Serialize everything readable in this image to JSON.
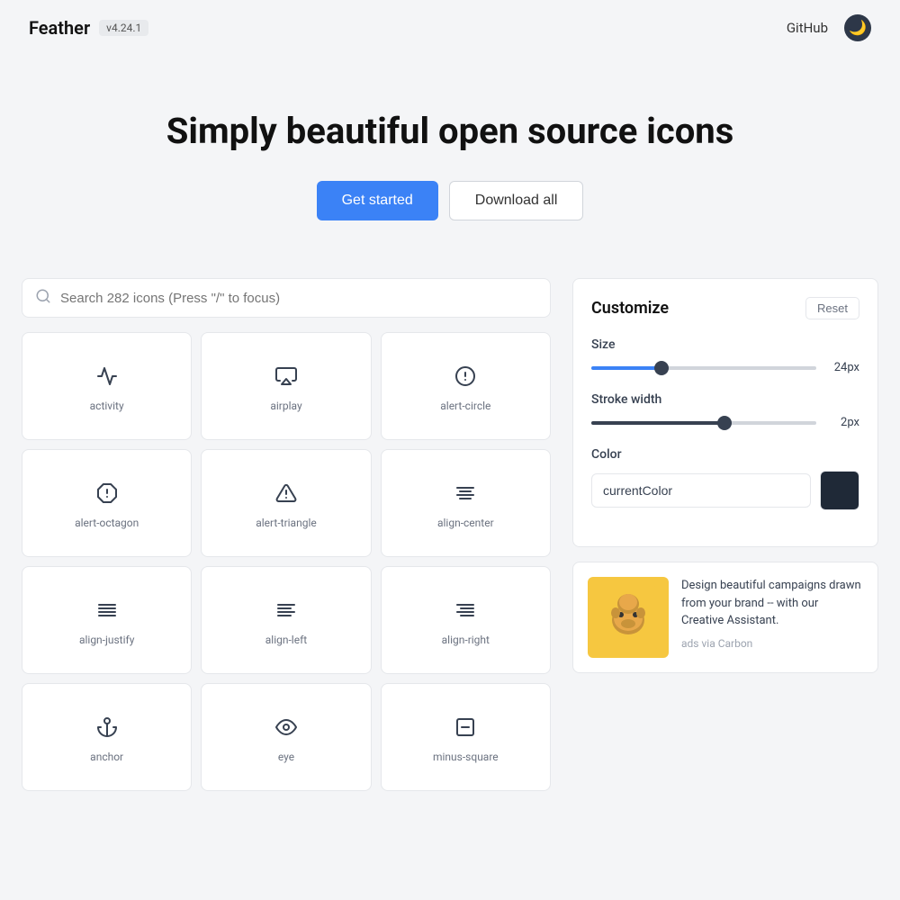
{
  "header": {
    "brand": "Feather",
    "version": "v4.24.1",
    "github_label": "GitHub",
    "dark_mode_icon": "🌙"
  },
  "hero": {
    "title": "Simply beautiful open source icons",
    "btn_get_started": "Get started",
    "btn_download": "Download all"
  },
  "search": {
    "placeholder": "Search 282 icons (Press \"/\" to focus)"
  },
  "customize": {
    "title": "Customize",
    "reset_label": "Reset",
    "size_label": "Size",
    "size_value": "24px",
    "size_percent": 30,
    "stroke_label": "Stroke width",
    "stroke_value": "2px",
    "stroke_percent": 60,
    "color_label": "Color",
    "color_value": "currentColor"
  },
  "ad": {
    "text": "Design beautiful campaigns drawn from your brand -- with our Creative Assistant.",
    "source": "ads via Carbon"
  },
  "icons": [
    {
      "id": "activity",
      "label": "activity",
      "type": "activity"
    },
    {
      "id": "airplay",
      "label": "airplay",
      "type": "airplay"
    },
    {
      "id": "alert-circle",
      "label": "alert-circle",
      "type": "alert-circle"
    },
    {
      "id": "alert-octagon",
      "label": "alert-octagon",
      "type": "alert-octagon"
    },
    {
      "id": "alert-triangle",
      "label": "alert-triangle",
      "type": "alert-triangle"
    },
    {
      "id": "align-center",
      "label": "align-center",
      "type": "align-center"
    },
    {
      "id": "align-justify",
      "label": "align-justify",
      "type": "align-justify"
    },
    {
      "id": "align-left",
      "label": "align-left",
      "type": "align-left"
    },
    {
      "id": "align-right",
      "label": "align-right",
      "type": "align-right"
    },
    {
      "id": "anchor",
      "label": "anchor",
      "type": "anchor"
    },
    {
      "id": "eye",
      "label": "eye",
      "type": "eye"
    },
    {
      "id": "minus-square",
      "label": "minus-square",
      "type": "minus-square"
    }
  ]
}
